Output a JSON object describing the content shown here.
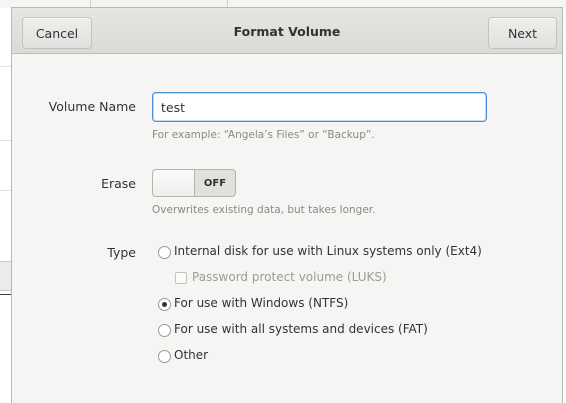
{
  "dialog": {
    "title": "Format Volume",
    "cancel_label": "Cancel",
    "next_label": "Next"
  },
  "volume_name": {
    "label": "Volume Name",
    "value": "test",
    "hint": "For example: “Angela’s Files” or “Backup”."
  },
  "erase": {
    "label": "Erase",
    "state_label": "OFF",
    "hint": "Overwrites existing data, but takes longer."
  },
  "type": {
    "label": "Type",
    "options": [
      {
        "label": "Internal disk for use with Linux systems only (Ext4)",
        "checked": false
      },
      {
        "label": "For use with Windows (NTFS)",
        "checked": true
      },
      {
        "label": "For use with all systems and devices (FAT)",
        "checked": false
      },
      {
        "label": "Other",
        "checked": false
      }
    ],
    "luks_label": "Password protect volume (LUKS)",
    "luks_checked": false
  }
}
